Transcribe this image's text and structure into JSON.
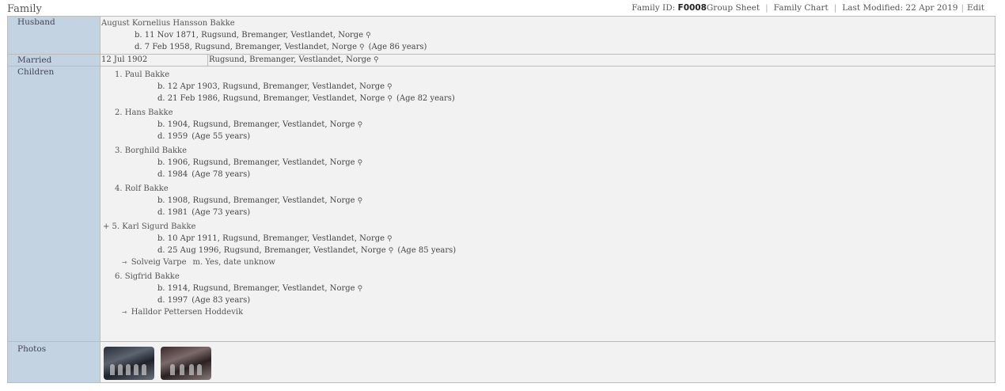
{
  "page": {
    "title": "Family"
  },
  "nav": {
    "family_id_label": "Family ID:",
    "family_id": "F0008",
    "group_sheet": "Group Sheet",
    "family_chart": "Family Chart",
    "last_modified": "Last Modified: 22 Apr 2019",
    "edit": "Edit"
  },
  "labels": {
    "husband": "Husband",
    "married": "Married",
    "children": "Children",
    "photos": "Photos"
  },
  "husband": {
    "name": "August Kornelius Hansson Bakke",
    "birth_prefix": "b.",
    "birth": "11 Nov 1871, Rugsund, Bremanger, Vestlandet, Norge",
    "death_prefix": "d.",
    "death": "7 Feb 1958, Rugsund, Bremanger, Vestlandet, Norge",
    "age": "(Age 86 years)"
  },
  "marriage": {
    "date": "12 Jul 1902",
    "place": "Rugsund, Bremanger, Vestlandet, Norge"
  },
  "children": [
    {
      "name": "1. Paul Bakke",
      "b": "12 Apr 1903, Rugsund, Bremanger, Vestlandet, Norge",
      "d": "21 Feb 1986, Rugsund, Bremanger, Vestlandet, Norge",
      "age": "(Age 82 years)"
    },
    {
      "name": "2. Hans Bakke",
      "b": "1904, Rugsund, Bremanger, Vestlandet, Norge",
      "d": "1959",
      "age": "(Age 55 years)"
    },
    {
      "name": "3. Borghild Bakke",
      "b": "1906, Rugsund, Bremanger, Vestlandet, Norge",
      "d": "1984",
      "age": "(Age 78 years)"
    },
    {
      "name": "4. Rolf Bakke",
      "b": "1908, Rugsund, Bremanger, Vestlandet, Norge",
      "d": "1981",
      "age": "(Age 73 years)"
    },
    {
      "name": "+ 5. Karl Sigurd Bakke",
      "b": "10 Apr 1911, Rugsund, Bremanger, Vestlandet, Norge",
      "d": "25 Aug 1996, Rugsund, Bremanger, Vestlandet, Norge",
      "age": "(Age 85 years)",
      "spouse": "Solveig Varpe",
      "spouse_marr": "m. Yes, date unknow"
    },
    {
      "name": "6. Sigfrid Bakke",
      "b": "1914, Rugsund, Bremanger, Vestlandet, Norge",
      "d": "1997",
      "age": "(Age 83 years)",
      "spouse": "Halldor Pettersen Hoddevik"
    }
  ],
  "icons": {
    "place": "pin-icon",
    "spouse": "spouse-arrow-icon"
  }
}
